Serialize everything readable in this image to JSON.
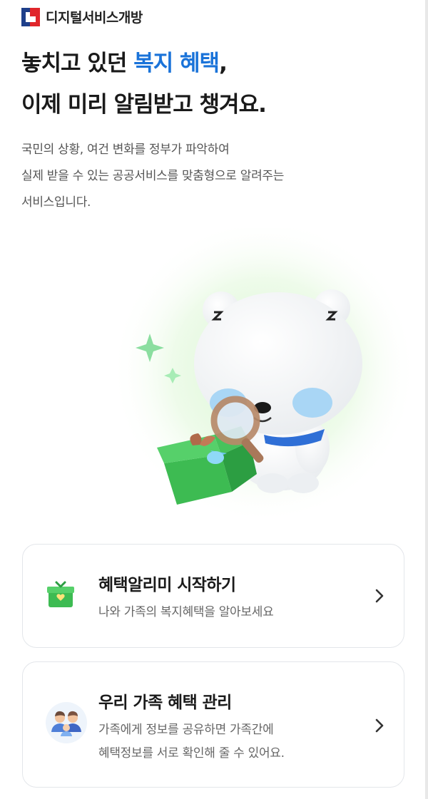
{
  "header": {
    "brand": "디지털서비스개방",
    "logo_icon": "digital-service-logo-icon"
  },
  "headline": {
    "line1_prefix": "놓치고 있던 ",
    "line1_accent": "복지 혜택",
    "line1_suffix": ",",
    "line2": "이제 미리 알림받고 챙겨요."
  },
  "description": {
    "line1": "국민의 상황, 여건 변화를 정부가 파악하여",
    "line2": "실제 받을 수 있는 공공서비스를 맞춤형으로 알려주는",
    "line3": "서비스입니다."
  },
  "hero": {
    "illustration": "polar-bear-magnifying-glass-gift-illustration"
  },
  "cards": [
    {
      "title": "혜택알리미 시작하기",
      "subtitle": "나와 가족의 복지혜택을 알아보세요",
      "icon": "gift-box-icon"
    },
    {
      "title": "우리 가족 혜택 관리",
      "subtitle_line1": "가족에게 정보를 공유하면 가족간에",
      "subtitle_line2": "혜택정보를 서로 확인해 줄 수 있어요.",
      "icon": "family-icon"
    }
  ],
  "colors": {
    "accent": "#1a73d9",
    "gift_green": "#3dbb52",
    "card_border": "#e3e6ea"
  }
}
